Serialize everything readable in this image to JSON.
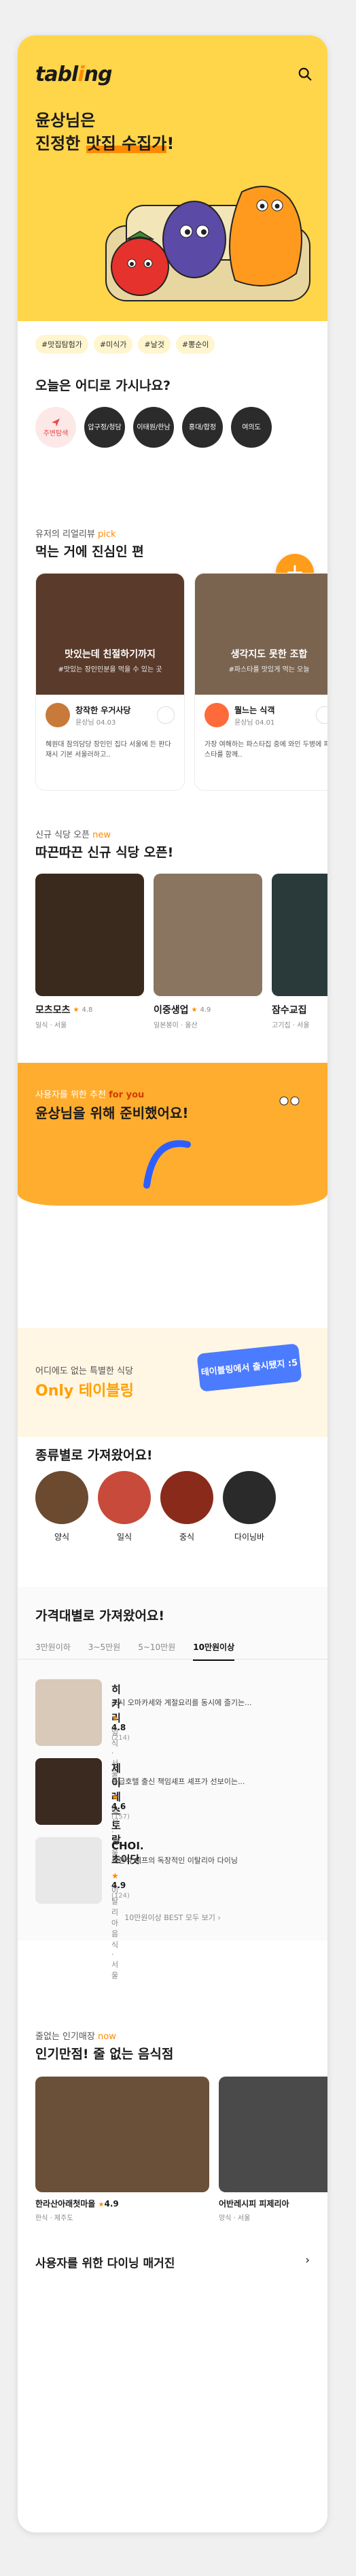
{
  "header": {
    "logo_text": "tabl",
    "logo_rest": "ng",
    "logo_mark": "i"
  },
  "hero": {
    "line1": "윤상님은",
    "line2_a": "진정한 ",
    "line2_b": "맛집 수집가",
    "line2_c": "!",
    "tags": [
      "#맛집탐험가",
      "#미식가",
      "#날것",
      "#뽕순이"
    ]
  },
  "regions": {
    "title": "오늘은 어디로 가시나요?",
    "items": [
      "주변탐색",
      "압구정/청담",
      "이태원/한남",
      "홍대/합정",
      "여의도"
    ]
  },
  "reviews": {
    "eyebrow": "유저의 리얼리뷰",
    "eyebrow_accent": "pick",
    "title": "먹는 거에 진심인 편",
    "cards": [
      {
        "caption": "맛있는데 친절하기까지",
        "caption_sub": "#맛있는 장인인분을 먹을 수 있는 곳",
        "shop": "창작한 우거사당",
        "meta": "윤상님 04.03",
        "body": "혜원대 참의담당 장인인 집다 서울에 든 판다 재시 기본 서울러하고.."
      },
      {
        "caption": "생각지도 못한 조합",
        "caption_sub": "#파스타를 맛있게 먹는 오늘",
        "shop": "뭘느는 식객",
        "meta": "윤상님 04.01",
        "body": "가장 여해하는 파스타집 중에 와인 두병에 파스타를 함께.."
      }
    ]
  },
  "new_places": {
    "eyebrow": "신규 식당 오픈",
    "eyebrow_accent": "new",
    "title": "따끈따끈 신규 식당 오픈!",
    "cards": [
      {
        "name": "모츠모츠",
        "rating": "4.8",
        "sub": "일식 · 서울"
      },
      {
        "name": "이중생업",
        "rating": "4.9",
        "sub": "일본봉이 · 울산"
      },
      {
        "name": "잠수교집",
        "rating": "",
        "sub": "고기집 · 서울"
      }
    ]
  },
  "for_you": {
    "line1": "사용자를 위한 추천 ",
    "line1_accent": "for you",
    "title": "윤상님을 위해 준비했어요!"
  },
  "tableing": {
    "line1": "어디에도 없는 특별한 식당",
    "title": "Only 테이블링",
    "bubble": "테이블링에서\n출시됐지 :5"
  },
  "categories": {
    "title": "종류별로 가져왔어요!",
    "items": [
      "양식",
      "일식",
      "중식",
      "다이닝바"
    ]
  },
  "price": {
    "title": "가격대별로 가져왔어요!",
    "tabs": [
      "3만원이하",
      "3~5만원",
      "5~10만원",
      "10만원이상"
    ],
    "items": [
      {
        "name": "히카리",
        "desc": "스시 오마카세와 계절요리를 동시에 즐기는...",
        "rating": "4.8",
        "count": "(214)",
        "loc": "일식 · 서울"
      },
      {
        "name": "제이레스토랑",
        "desc": "특급호텔 출신 책임셰프 셰프가 선보이는...",
        "rating": "4.6",
        "count": "(157)",
        "loc": "일식 · 서울"
      },
      {
        "name": "CHOI. 초이닷",
        "desc": "최현석 셰프의 독창적인 이탈리아 다이닝",
        "rating": "4.9",
        "count": "(124)",
        "loc": "이탈리아 음식 · 서울"
      }
    ],
    "more": "10만원이상 BEST 모두 보기  ›"
  },
  "popular": {
    "eyebrow": "줄없는 인기매장",
    "eyebrow_accent": "now",
    "title": "인기만점! 줄 없는 음식점",
    "cards": [
      {
        "name": "한라산아래첫마을",
        "rating": "4.9",
        "sub": "한식 · 제주도"
      },
      {
        "name": "어반레시피 피제리아",
        "rating": "",
        "sub": "양식 · 서울"
      }
    ]
  },
  "magazine": {
    "title": "사용자를 위한 다이닝 매거진",
    "arrow": "›"
  }
}
